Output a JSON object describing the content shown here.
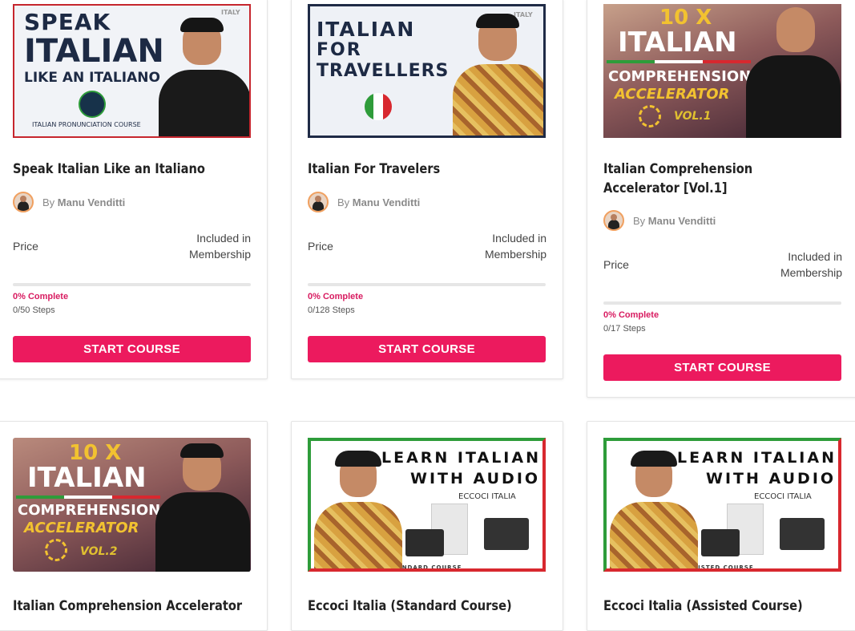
{
  "courses": [
    {
      "title": "Speak Italian Like an Italiano",
      "thumb": {
        "line1": "SPEAK",
        "line2": "ITALIAN",
        "line3": "LIKE AN ITALIANO",
        "footer": "ITALIAN PRONUNCIATION COURSE",
        "corner": "ITALY"
      },
      "author_prefix": "By",
      "author": "Manu Venditti",
      "price_label": "Price",
      "price_value_1": "Included in",
      "price_value_2": "Membership",
      "progress_text": "0% Complete",
      "steps_text": "0/50 Steps",
      "progress": 0,
      "button": "START COURSE"
    },
    {
      "title": "Italian For Travelers",
      "thumb": {
        "line1": "ITALIAN",
        "line2": "FOR",
        "line3": "TRAVELLERS",
        "corner": "ITALY"
      },
      "author_prefix": "By",
      "author": "Manu Venditti",
      "price_label": "Price",
      "price_value_1": "Included in",
      "price_value_2": "Membership",
      "progress_text": "0% Complete",
      "steps_text": "0/128 Steps",
      "progress": 0,
      "button": "START COURSE"
    },
    {
      "title": "Italian Comprehension Accelerator [Vol.1]",
      "thumb": {
        "line1": "10 X",
        "line2": "ITALIAN",
        "line3": "COMPREHENSION",
        "line4": "ACCELERATOR",
        "vol": "VOL.1"
      },
      "author_prefix": "By",
      "author": "Manu Venditti",
      "price_label": "Price",
      "price_value_1": "Included in",
      "price_value_2": "Membership",
      "progress_text": "0% Complete",
      "steps_text": "0/17 Steps",
      "progress": 0,
      "button": "START COURSE"
    },
    {
      "title": "Italian Comprehension Accelerator",
      "thumb": {
        "line1": "10 X",
        "line2": "ITALIAN",
        "line3": "COMPREHENSION",
        "line4": "ACCELERATOR",
        "vol": "VOL.2"
      }
    },
    {
      "title": "Eccoci Italia (Standard Course)",
      "thumb": {
        "line1": "LEARN ITALIAN",
        "line2": "WITH AUDIO",
        "line3": "ECCOCI ITALIA",
        "footer": "STANDARD COURSE"
      }
    },
    {
      "title": "Eccoci Italia (Assisted Course)",
      "thumb": {
        "line1": "LEARN ITALIAN",
        "line2": "WITH AUDIO",
        "line3": "ECCOCI ITALIA",
        "footer": "ASSISTED COURSE"
      }
    }
  ],
  "colors": {
    "accent": "#ec1a5e",
    "progress_text": "#d81b60",
    "italy_green": "#2e9c3a",
    "italy_red": "#d8282f"
  }
}
